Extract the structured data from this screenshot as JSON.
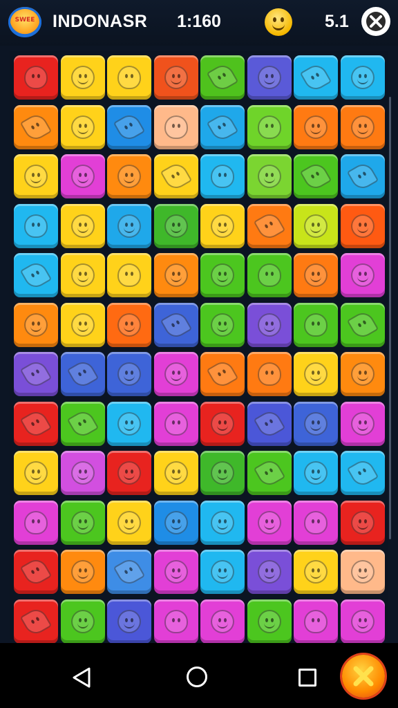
{
  "header": {
    "logo_icon": "game-logo-icon",
    "logo_text": "SWEE",
    "title": "INDONASR",
    "score": "1:160",
    "mood_icon": "smiley-icon",
    "moves": "5.1",
    "close_icon": "close-icon"
  },
  "board": {
    "rows": [
      [
        "#e8231f",
        "#ffd21a",
        "#ffd21a",
        "#f0521c",
        "#4fc21d",
        "#5a5ad8",
        "#20b8f0",
        "#20b8f0"
      ],
      [
        "#ff8a0f",
        "#ffd21a",
        "#1f8de6",
        "#ffb98a",
        "#1fa8ea",
        "#6fd42a",
        "#ff7a12",
        "#ff7a12"
      ],
      [
        "#ffd21a",
        "#e23fd6",
        "#ff8a0f",
        "#ffd21a",
        "#20b8f0",
        "#7bd531",
        "#4cc61f",
        "#1fa8ea"
      ],
      [
        "#20b8f0",
        "#ffd21a",
        "#1fa8ea",
        "#3fb82a",
        "#ffd21a",
        "#ff7a12",
        "#c8e41a",
        "#ff5a12"
      ],
      [
        "#20b8f0",
        "#ffd21a",
        "#ffd21a",
        "#ff8a0f",
        "#4cc61f",
        "#4cc61f",
        "#ff7a12",
        "#e23fd6"
      ],
      [
        "#ff8a0f",
        "#ffd21a",
        "#ff6a12",
        "#3e64d8",
        "#4cc61f",
        "#7a4fd8",
        "#4cc61f",
        "#4cc61f"
      ],
      [
        "#7a4fd8",
        "#3e64d8",
        "#3e64d8",
        "#e23fd6",
        "#ff7a12",
        "#ff7a12",
        "#ffd21a",
        "#ff8a0f"
      ],
      [
        "#e8231f",
        "#4cc61f",
        "#20b8f0",
        "#e23fd6",
        "#e8231f",
        "#4b57d8",
        "#3e64d8",
        "#e23fd6"
      ],
      [
        "#ffd21a",
        "#d24fe0",
        "#e8231f",
        "#ffd21a",
        "#3fb82a",
        "#4cc61f",
        "#20b8f0",
        "#20b8f0"
      ],
      [
        "#e23fd6",
        "#4cc61f",
        "#ffd21a",
        "#1f8de6",
        "#20b8f0",
        "#e23fd6",
        "#e23fd6",
        "#e8231f"
      ],
      [
        "#e8231f",
        "#ff8a0f",
        "#3e8de6",
        "#e23fd6",
        "#20b8f0",
        "#7a4fd8",
        "#ffd21a",
        "#ffb98a"
      ],
      [
        "#e8231f",
        "#4cc61f",
        "#4b57d8",
        "#e23fd6",
        "#e23fd6",
        "#4cc61f",
        "#e23fd6",
        "#e23fd6"
      ]
    ],
    "shapes": [
      [
        "fruit",
        "face",
        "fruit",
        "face",
        "leaf",
        "face",
        "leaf",
        "face"
      ],
      [
        "leaf",
        "face",
        "leaf",
        "fruit",
        "leaf",
        "fruit",
        "face",
        "face"
      ],
      [
        "face",
        "face",
        "face",
        "leaf",
        "fruit",
        "face",
        "leaf",
        "leaf"
      ],
      [
        "fruit",
        "face",
        "face",
        "face",
        "face",
        "leaf",
        "face",
        "face"
      ],
      [
        "leaf",
        "face",
        "fruit",
        "face",
        "face",
        "fruit",
        "face",
        "face"
      ],
      [
        "face",
        "face",
        "face",
        "leaf",
        "face",
        "face",
        "fruit",
        "leaf"
      ],
      [
        "leaf",
        "leaf",
        "face",
        "face",
        "leaf",
        "fruit",
        "face",
        "face"
      ],
      [
        "leaf",
        "leaf",
        "face",
        "fruit",
        "face",
        "leaf",
        "face",
        "face"
      ],
      [
        "face",
        "face",
        "face",
        "face",
        "face",
        "leaf",
        "face",
        "leaf"
      ],
      [
        "fruit",
        "face",
        "face",
        "face",
        "face",
        "face",
        "fruit",
        "face"
      ],
      [
        "leaf",
        "face",
        "leaf",
        "face",
        "face",
        "face",
        "face",
        "face"
      ],
      [
        "leaf",
        "face",
        "face",
        "fruit",
        "face",
        "face",
        "fruit",
        "face"
      ]
    ]
  },
  "navbar": {
    "back_icon": "back-triangle-icon",
    "home_icon": "home-circle-icon",
    "recent_icon": "recent-apps-icon",
    "action_icon": "x-icon"
  }
}
